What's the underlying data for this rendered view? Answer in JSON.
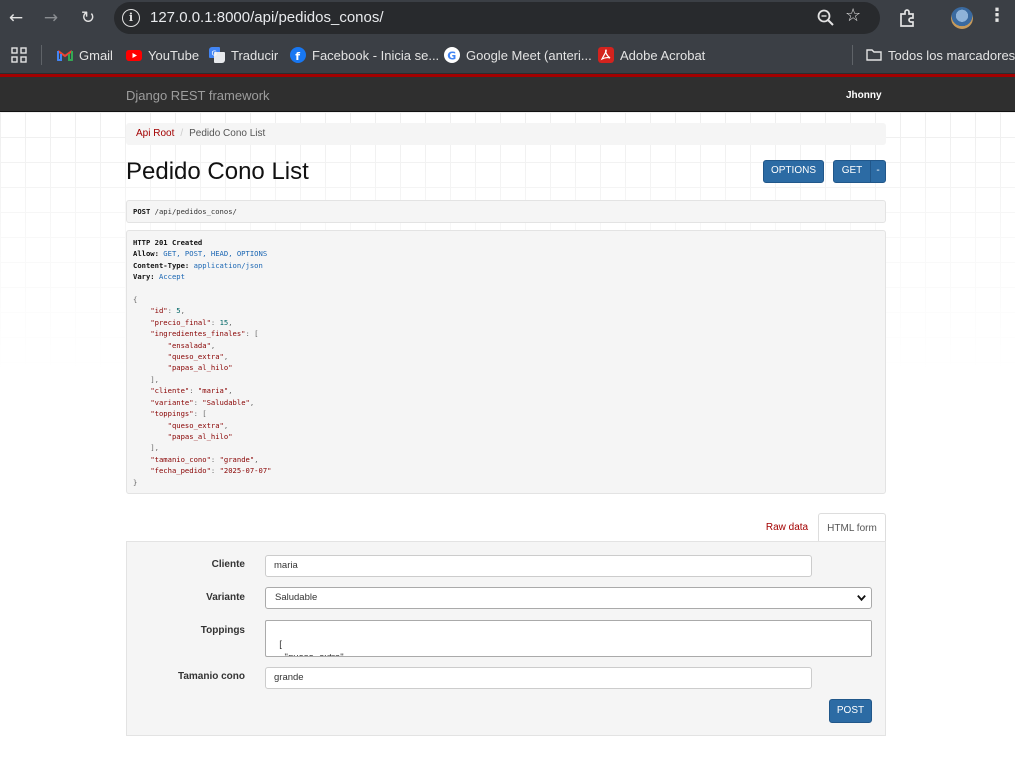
{
  "browser": {
    "url": "127.0.0.1:8000/api/pedidos_conos/",
    "bookmarks": [
      {
        "label": "Gmail",
        "icon": "gmail-icon"
      },
      {
        "label": "YouTube",
        "icon": "youtube-icon"
      },
      {
        "label": "Traducir",
        "icon": "translate-icon"
      },
      {
        "label": "Facebook - Inicia se...",
        "icon": "facebook-icon"
      },
      {
        "label": "Google Meet (anteri...",
        "icon": "google-icon"
      },
      {
        "label": "Adobe Acrobat",
        "icon": "acrobat-icon"
      }
    ],
    "bookmarks_folder": "Todos los marcadores"
  },
  "navbar": {
    "brand": "Django REST framework",
    "user": "Jhonny"
  },
  "breadcrumb": {
    "root": "Api Root",
    "current": "Pedido Cono List"
  },
  "page": {
    "title": "Pedido Cono List",
    "options_label": "OPTIONS",
    "get_label": "GET",
    "caret": "-"
  },
  "request": {
    "method": "POST",
    "path": "/api/pedidos_conos/"
  },
  "response": {
    "status": "HTTP 201 Created",
    "headers": [
      {
        "name": "Allow:",
        "value": "GET, POST, HEAD, OPTIONS"
      },
      {
        "name": "Content-Type:",
        "value": "application/json"
      },
      {
        "name": "Vary:",
        "value": "Accept"
      }
    ],
    "body": {
      "id": 5,
      "precio_final": 15,
      "ingredientes_finales": [
        "ensalada",
        "queso_extra",
        "papas_al_hilo"
      ],
      "cliente": "maria",
      "variante": "Saludable",
      "toppings": [
        "queso_extra",
        "papas_al_hilo"
      ],
      "tamanio_cono": "grande",
      "fecha_pedido": "2025-07-07"
    }
  },
  "tabs": {
    "raw": "Raw data",
    "html": "HTML form"
  },
  "form": {
    "cliente_label": "Cliente",
    "cliente_value": "maria",
    "variante_label": "Variante",
    "variante_value": "Saludable",
    "toppings_label": "Toppings",
    "toppings_value": "[\n    \"queso_extra\",\n    \"papas_al_hilo\"",
    "tamanio_label": "Tamanio cono",
    "tamanio_value": "grande",
    "post_label": "POST"
  },
  "colors": {
    "drf_red": "#a30000",
    "button_blue": "#2c6ba4",
    "chrome_dark": "#3b3f45"
  }
}
